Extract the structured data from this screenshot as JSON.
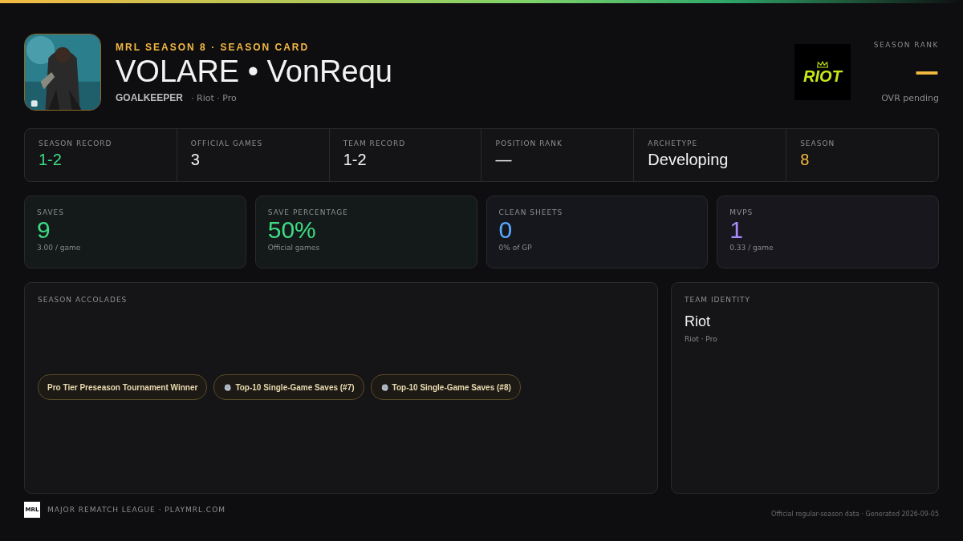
{
  "header": {
    "eyebrow": "MRL SEASON 8 · SEASON CARD",
    "title": "VOLARE • VonRequ",
    "position": "GOALKEEPER",
    "team_line": "· Riot · Pro"
  },
  "team_logo": {
    "text": "RIOT"
  },
  "season_rank": {
    "label": "SEASON RANK",
    "value": "—",
    "note": "OVR pending"
  },
  "record_strip": [
    {
      "label": "SEASON RECORD",
      "value": "1-2",
      "color": "#3ddc84"
    },
    {
      "label": "OFFICIAL GAMES",
      "value": "3",
      "color": "#f2f2f2"
    },
    {
      "label": "TEAM RECORD",
      "value": "1-2",
      "color": "#f2f2f2"
    },
    {
      "label": "POSITION RANK",
      "value": "—",
      "color": "#f2f2f2"
    },
    {
      "label": "ARCHETYPE",
      "value": "Developing",
      "color": "#f2f2f2"
    },
    {
      "label": "SEASON",
      "value": "8",
      "color": "#f5b942"
    }
  ],
  "stat_cards": [
    {
      "label": "SAVES",
      "value": "9",
      "sub": "3.00 / game",
      "color": "#3ddc84"
    },
    {
      "label": "SAVE PERCENTAGE",
      "value": "50%",
      "sub": "Official games",
      "color": "#3ddc84"
    },
    {
      "label": "CLEAN SHEETS",
      "value": "0",
      "sub": "0% of GP",
      "color": "#5aa9ff"
    },
    {
      "label": "MVPS",
      "value": "1",
      "sub": "0.33 / game",
      "color": "#a98bff"
    }
  ],
  "accolades": {
    "title": "SEASON ACCOLADES",
    "items": [
      {
        "kind": "award",
        "label": "Pro Tier Preseason Tournament Winner"
      },
      {
        "kind": "glove",
        "label": "Top-10 Single-Game Saves (#7)"
      },
      {
        "kind": "glove",
        "label": "Top-10 Single-Game Saves (#8)"
      }
    ]
  },
  "team_identity": {
    "title": "TEAM IDENTITY",
    "name": "Riot",
    "sub": "Riot · Pro"
  },
  "footer": {
    "logo_text": "MRL",
    "brand": "MAJOR REMATCH LEAGUE · PLAYMRL.COM",
    "note": "Official regular-season data · Generated 2026-09-05"
  }
}
